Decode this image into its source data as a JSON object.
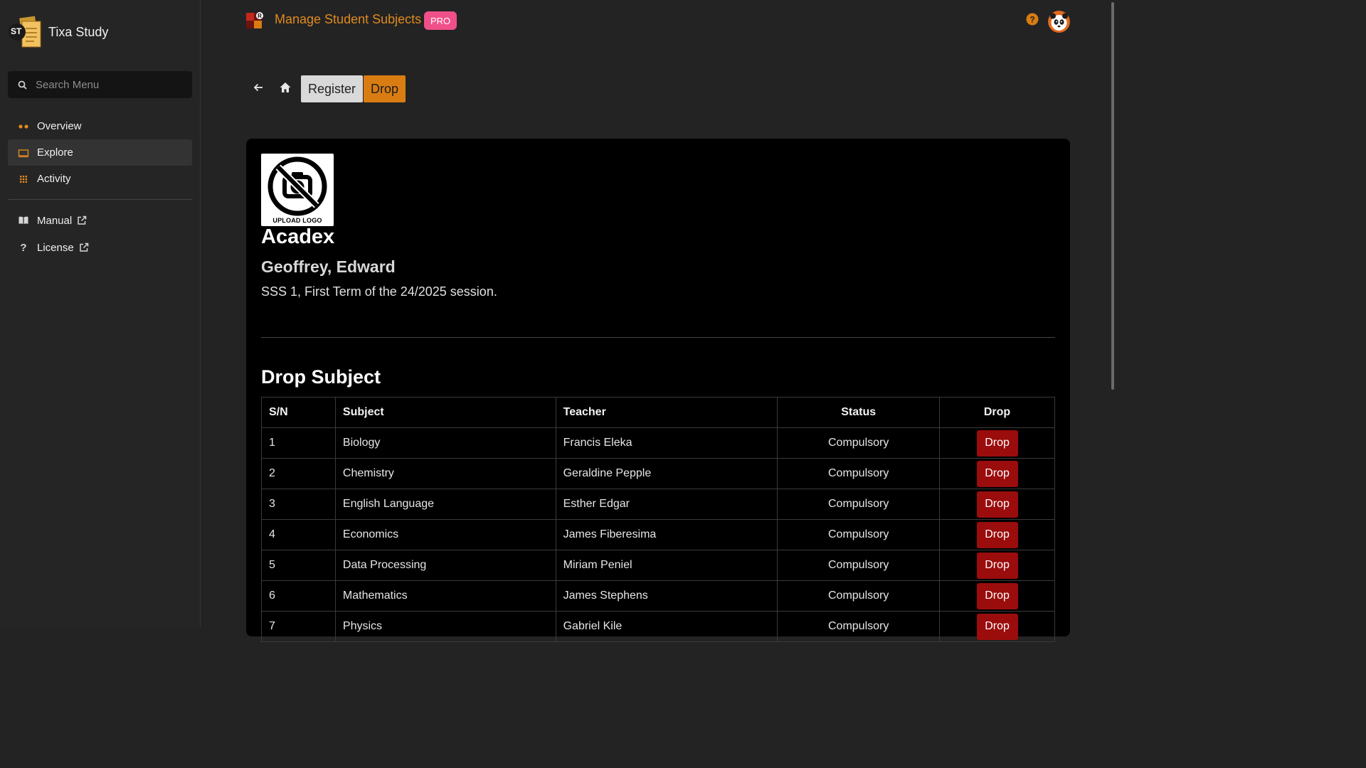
{
  "sidebar": {
    "brand_initials": "ST",
    "brand_name": "Tixa Study",
    "search_placeholder": "Search Menu",
    "nav": [
      {
        "label": "Overview",
        "icon": "dots-icon"
      },
      {
        "label": "Explore",
        "icon": "monitor-icon",
        "active": true
      },
      {
        "label": "Activity",
        "icon": "grid-icon"
      }
    ],
    "links": [
      {
        "label": "Manual",
        "icon": "book-icon"
      },
      {
        "label": "License",
        "icon": "question-icon"
      }
    ]
  },
  "header": {
    "title": "Manage Student Subjects",
    "badge": "PRO"
  },
  "toolbar": {
    "register_label": "Register",
    "drop_label": "Drop"
  },
  "profile": {
    "logo_caption": "UPLOAD LOGO",
    "school_name": "Acadex",
    "student_name": "Geoffrey, Edward",
    "session_text": "SSS 1, First Term of the 24/2025 session."
  },
  "drop_section": {
    "title": "Drop Subject",
    "columns": [
      "S/N",
      "Subject",
      "Teacher",
      "Status",
      "Drop"
    ],
    "rows": [
      {
        "sn": "1",
        "subject": "Biology",
        "teacher": "Francis Eleka",
        "status": "Compulsory",
        "action": "Drop"
      },
      {
        "sn": "2",
        "subject": "Chemistry",
        "teacher": "Geraldine Pepple",
        "status": "Compulsory",
        "action": "Drop"
      },
      {
        "sn": "3",
        "subject": "English Language",
        "teacher": "Esther Edgar",
        "status": "Compulsory",
        "action": "Drop"
      },
      {
        "sn": "4",
        "subject": "Economics",
        "teacher": "James Fiberesima",
        "status": "Compulsory",
        "action": "Drop"
      },
      {
        "sn": "5",
        "subject": "Data Processing",
        "teacher": "Miriam Peniel",
        "status": "Compulsory",
        "action": "Drop"
      },
      {
        "sn": "6",
        "subject": "Mathematics",
        "teacher": "James Stephens",
        "status": "Compulsory",
        "action": "Drop"
      },
      {
        "sn": "7",
        "subject": "Physics",
        "teacher": "Gabriel Kile",
        "status": "Compulsory",
        "action": "Drop"
      }
    ]
  },
  "colors": {
    "accent": "#d97d12",
    "title": "#e08a1e",
    "pro_badge": "#f0508a",
    "drop_button": "#9b0c0c"
  }
}
